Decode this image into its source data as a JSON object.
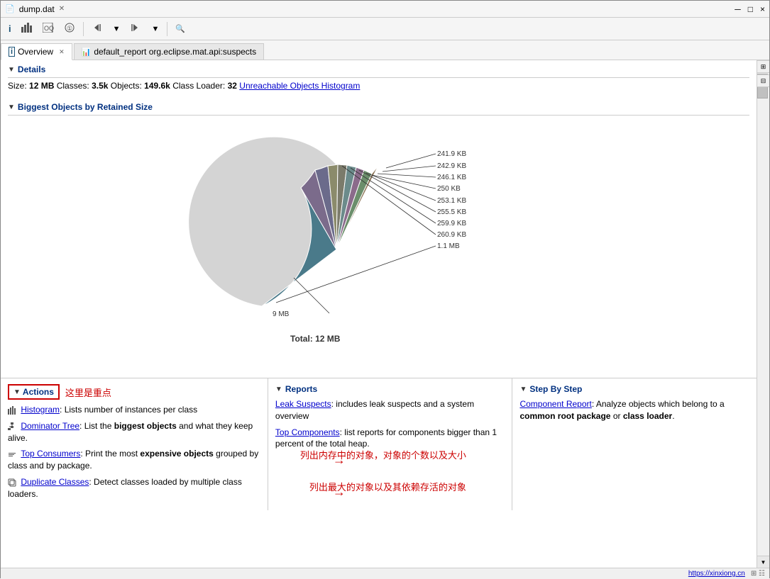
{
  "window": {
    "title": "dump.dat",
    "close": "×",
    "minimize": "─",
    "maximize": "□"
  },
  "toolbar": {
    "buttons": [
      {
        "name": "info-btn",
        "icon": "ℹ",
        "label": ""
      },
      {
        "name": "chart-btn",
        "icon": "▦",
        "label": ""
      },
      {
        "name": "table-btn",
        "icon": "⊞",
        "label": "OQL"
      },
      {
        "name": "oql-btn",
        "icon": "⊡",
        "label": ""
      },
      {
        "name": "run-btn",
        "icon": "▶",
        "label": ""
      },
      {
        "name": "nav-back",
        "icon": "◀",
        "label": ""
      },
      {
        "name": "nav-fwd",
        "icon": "▶",
        "label": ""
      },
      {
        "name": "search-btn",
        "icon": "🔍",
        "label": ""
      }
    ]
  },
  "tabs": [
    {
      "id": "overview",
      "label": "Overview",
      "icon": "ℹ",
      "active": true,
      "closeable": true
    },
    {
      "id": "default_report",
      "label": "default_report  org.eclipse.mat.api:suspects",
      "icon": "📊",
      "active": false,
      "closeable": false
    }
  ],
  "details": {
    "header": "Details",
    "size_label": "Size:",
    "size_value": "12 MB",
    "classes_label": "Classes:",
    "classes_value": "3.5k",
    "objects_label": "Objects:",
    "objects_value": "149.6k",
    "classloader_label": "Class Loader:",
    "classloader_value": "32",
    "link_text": "Unreachable Objects Histogram"
  },
  "biggest_objects": {
    "header": "Biggest Objects by Retained Size",
    "total_label": "Total: 12 MB",
    "chart": {
      "large_slice_label": "9 MB",
      "slices": [
        {
          "label": "241.9 KB",
          "color": "#8B7355"
        },
        {
          "label": "242.9 KB",
          "color": "#6B8E6B"
        },
        {
          "label": "246.1 KB",
          "color": "#8B6B8B"
        },
        {
          "label": "250 KB",
          "color": "#6B8B8B"
        },
        {
          "label": "253.1 KB",
          "color": "#7B7B6B"
        },
        {
          "label": "255.5 KB",
          "color": "#8B8B6B"
        },
        {
          "label": "259.9 KB",
          "color": "#6B6B8B"
        },
        {
          "label": "260.9 KB",
          "color": "#7B6B8B"
        },
        {
          "label": "1.1 MB",
          "color": "#4A7A8A"
        }
      ],
      "main_color": "#d0d0d0"
    }
  },
  "actions": {
    "header": "Actions",
    "annotation": "这里是重点",
    "items": [
      {
        "link": "Histogram",
        "desc": ": Lists number of instances per class",
        "icon": "chart"
      },
      {
        "link": "Dominator Tree",
        "desc": ": List the ",
        "bold": "biggest objects",
        "desc2": " and what they keep alive.",
        "icon": "tree"
      },
      {
        "link": "Top Consumers",
        "desc": ": Print the most ",
        "bold": "expensive objects",
        "desc2": " grouped by class and by package.",
        "icon": "link",
        "annotation": "列出内存中的对象，对象的个数以及大小"
      },
      {
        "link": "Duplicate Classes",
        "desc": ": Detect classes loaded by multiple class loaders.",
        "icon": "link",
        "annotation": "列出最大的对象以及其依赖存活的对象"
      }
    ]
  },
  "reports": {
    "header": "Reports",
    "items": [
      {
        "link": "Leak Suspects",
        "desc": ": includes leak suspects and a system overview"
      },
      {
        "link": "Top Components",
        "desc": ": list reports for components bigger than 1 percent of the total heap."
      }
    ]
  },
  "step_by_step": {
    "header": "Step By Step",
    "items": [
      {
        "link": "Component Report",
        "desc": ": Analyze objects which belong to a ",
        "bold1": "common root package",
        "desc2": " or ",
        "bold2": "class loader",
        "desc3": "."
      }
    ]
  },
  "status_bar": {
    "link": "https://xinxiong.cn"
  }
}
